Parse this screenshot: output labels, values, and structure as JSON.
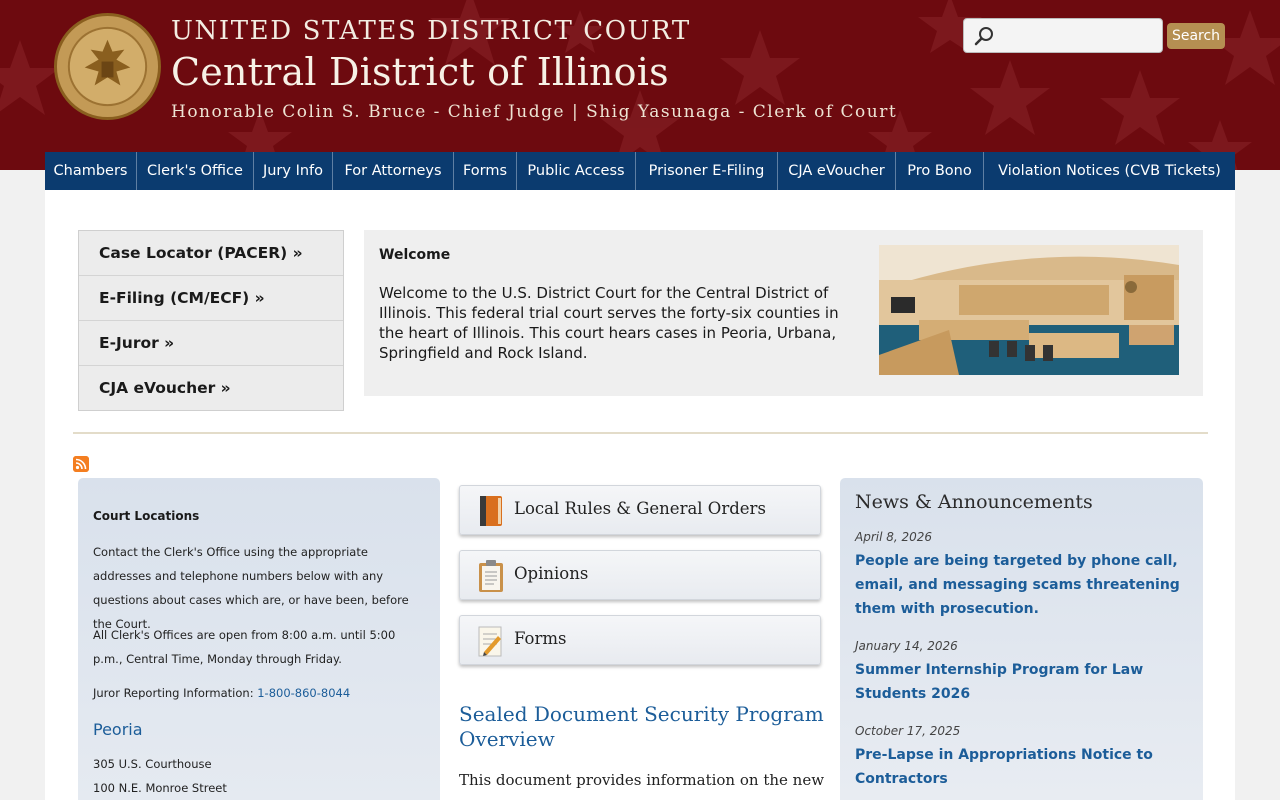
{
  "header": {
    "line1": "UNITED STATES DISTRICT COURT",
    "line2": "Central District of Illinois",
    "line3": "Honorable Colin S. Bruce - Chief Judge | Shig Yasunaga - Clerk of Court",
    "search_placeholder": "",
    "search_button": "Search"
  },
  "nav": [
    "Chambers",
    "Clerk's Office",
    "Jury Info",
    "For Attorneys",
    "Forms",
    "Public Access",
    "Prisoner E-Filing",
    "CJA eVoucher",
    "Pro Bono",
    "Violation Notices (CVB Tickets)"
  ],
  "quick_links": [
    "Case Locator (PACER) »",
    "E-Filing (CM/ECF) »",
    "E-Juror »",
    "CJA eVoucher »"
  ],
  "welcome": {
    "title": "Welcome",
    "text": "Welcome to the U.S. District Court for the Central District of Illinois.  This federal trial court serves the forty-six counties in the heart of Illinois.  This court hears cases in Peoria, Urbana, Springfield and Rock Island."
  },
  "locations": {
    "title": "Court Locations",
    "intro": "Contact the Clerk's Office using the appropriate addresses and telephone numbers below with any questions about cases which are, or have been, before the Court.",
    "hours": "All Clerk's Offices are open from 8:00 a.m. until 5:00 p.m., Central Time, Monday through Friday.",
    "juror_label": "Juror Reporting Information: ",
    "juror_phone": "1-800-860-8044",
    "city": "Peoria",
    "addr1": "305 U.S. Courthouse",
    "addr2": "100 N.E. Monroe Street"
  },
  "features": [
    {
      "label": "Local Rules & General Orders",
      "icon": "book-icon"
    },
    {
      "label": "Opinions",
      "icon": "clipboard-icon"
    },
    {
      "label": "Forms",
      "icon": "notepad-icon"
    }
  ],
  "sealed": {
    "title": "Sealed Document Security Program Overview",
    "text": "This document provides information on the new"
  },
  "news": {
    "heading": "News & Announcements",
    "items": [
      {
        "date": "April 8, 2026",
        "title": "People are being targeted by phone call, email, and messaging scams threatening them with prosecution."
      },
      {
        "date": "January 14, 2026",
        "title": "Summer Internship Program for Law Students 2026"
      },
      {
        "date": "October 17, 2025",
        "title": "Pre-Lapse in Appropriations Notice to Contractors"
      }
    ]
  },
  "colors": {
    "header_bg": "#6d0a0f",
    "nav_bg": "#0b3b6f",
    "link": "#1c5d99",
    "search_button": "#b58f52"
  }
}
